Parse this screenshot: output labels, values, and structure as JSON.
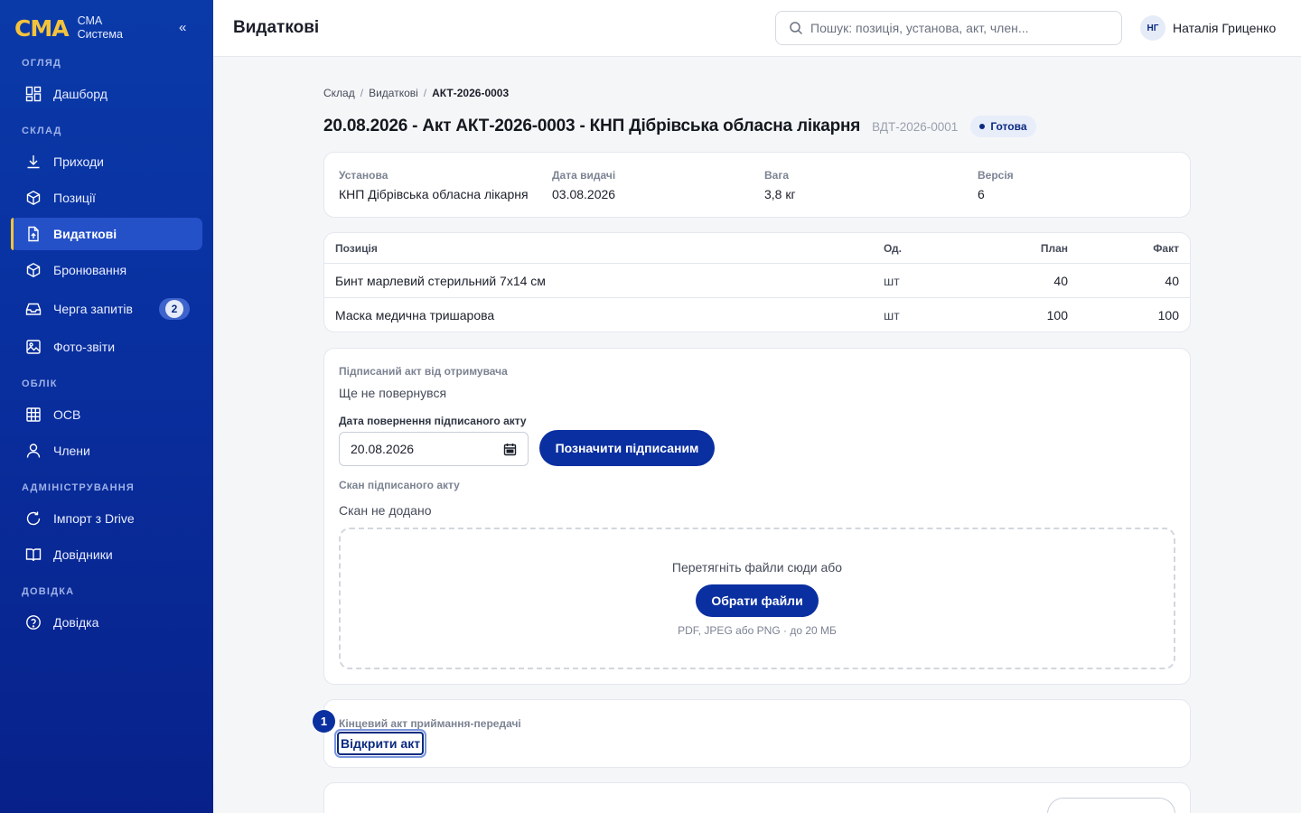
{
  "sidebar": {
    "logo": "СМА",
    "brand_line1": "СМА",
    "brand_line2": "Система",
    "collapse_label": "«",
    "sections": {
      "overview": "ОГЛЯД",
      "warehouse": "СКЛАД",
      "accounting": "ОБЛІК",
      "admin": "АДМІНІСТРУВАННЯ",
      "help": "ДОВІДКА"
    },
    "items": {
      "dashboard": "Дашборд",
      "arrivals": "Приходи",
      "positions": "Позиції",
      "expenses": "Видаткові",
      "reservations": "Бронювання",
      "queue": "Черга запитів",
      "queue_count": "2",
      "photo_reports": "Фото-звіти",
      "osv": "ОСВ",
      "members": "Члени",
      "import_drive": "Імпорт з Drive",
      "directories": "Довідники",
      "help": "Довідка"
    },
    "accent_color": "#f5c33b"
  },
  "header": {
    "title": "Видаткові",
    "search_placeholder": "Пошук: позиція, установа, акт, член...",
    "user_initials": "НГ",
    "user_name": "Наталія Гриценко"
  },
  "breadcrumb": {
    "items": [
      "Склад",
      "Видаткові"
    ],
    "separator": "/",
    "current": "АКТ-2026-0003"
  },
  "document": {
    "title": "20.08.2026 - Акт АКТ-2026-0003 - КНП Дібрівська обласна лікарня",
    "code": "ВДТ-2026-0001",
    "status": "Готова",
    "meta": {
      "institution_label": "Установа",
      "institution": "КНП Дібрівська обласна лікарня",
      "issue_date_label": "Дата видачі",
      "issue_date": "03.08.2026",
      "weight_label": "Вага",
      "weight": "3,8 кг",
      "version_label": "Версія",
      "version": "6"
    }
  },
  "items_table": {
    "headers": {
      "position": "Позиція",
      "unit": "Од.",
      "plan": "План",
      "fact": "Факт"
    },
    "rows": [
      {
        "position": "Бинт марлевий стерильний 7х14 см",
        "unit": "шт",
        "plan": "40",
        "fact": "40"
      },
      {
        "position": "Маска медична тришарова",
        "unit": "шт",
        "plan": "100",
        "fact": "100"
      }
    ]
  },
  "signed_act": {
    "label": "Підписаний акт від отримувача",
    "status": "Ще не повернувся",
    "return_date_label": "Дата повернення підписаного акту",
    "return_date": "20.08.2026",
    "mark_signed_button": "Позначити підписаним",
    "scan_label": "Скан підписаного акту",
    "scan_status": "Скан не додано",
    "drop_text": "Перетягніть файли сюди або",
    "choose_files_button": "Обрати файли",
    "drop_hint": "PDF, JPEG або PNG · до 20 МБ"
  },
  "final_act": {
    "marker": "1",
    "label": "Кінцевий акт приймання-передачі",
    "open_button": "Відкрити акт"
  },
  "primary_color": "#0a2fa0"
}
